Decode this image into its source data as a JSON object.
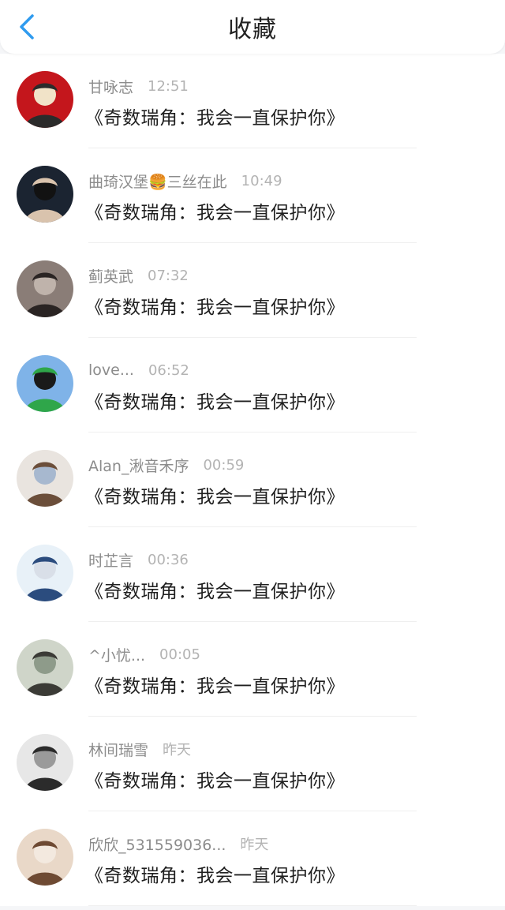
{
  "header": {
    "title": "收藏"
  },
  "items": [
    {
      "name": "甘咏志",
      "time": "12:51",
      "message": "《奇数瑞角：我会一直保护你》",
      "avatar_colors": [
        "#c4161c",
        "#2b2b2b",
        "#f1e3c8"
      ]
    },
    {
      "name": "曲琦汉堡🍔三丝在此",
      "time": "10:49",
      "message": "《奇数瑞角：我会一直保护你》",
      "avatar_colors": [
        "#1b2431",
        "#d9c3ad",
        "#121212"
      ]
    },
    {
      "name": "蓟英武",
      "time": "07:32",
      "message": "《奇数瑞角：我会一直保护你》",
      "avatar_colors": [
        "#8a7d77",
        "#2a2423",
        "#bfb3ab"
      ]
    },
    {
      "name": "love...",
      "time": "06:52",
      "message": "《奇数瑞角：我会一直保护你》",
      "avatar_colors": [
        "#7fb3e8",
        "#2fa64a",
        "#1a1a1a"
      ]
    },
    {
      "name": "Alan_湫音禾序",
      "time": "00:59",
      "message": "《奇数瑞角：我会一直保护你》",
      "avatar_colors": [
        "#e9e4df",
        "#6b4e3a",
        "#a7b8cf"
      ]
    },
    {
      "name": "时芷言",
      "time": "00:36",
      "message": "《奇数瑞角：我会一直保护你》",
      "avatar_colors": [
        "#e8f1f8",
        "#2b4c7e",
        "#d9dfe8"
      ]
    },
    {
      "name": "^小忧...",
      "time": "00:05",
      "message": "《奇数瑞角：我会一直保护你》",
      "avatar_colors": [
        "#cfd5c9",
        "#3b3b36",
        "#8e9b8a"
      ]
    },
    {
      "name": "林间瑞雪",
      "time": "昨天",
      "message": "《奇数瑞角：我会一直保护你》",
      "avatar_colors": [
        "#e7e7e7",
        "#2b2b2b",
        "#9a9a9a"
      ]
    },
    {
      "name": "欣欣_531559036...",
      "time": "昨天",
      "message": "《奇数瑞角：我会一直保护你》",
      "avatar_colors": [
        "#e9d8c8",
        "#6e4a33",
        "#f3e9df"
      ]
    }
  ],
  "icons": {
    "back": "chevron-left-icon"
  },
  "colors": {
    "accent": "#2f9bef",
    "title": "#222222",
    "name": "#8c8c8c",
    "time": "#b3b3b3",
    "message": "#1f1f1f"
  }
}
